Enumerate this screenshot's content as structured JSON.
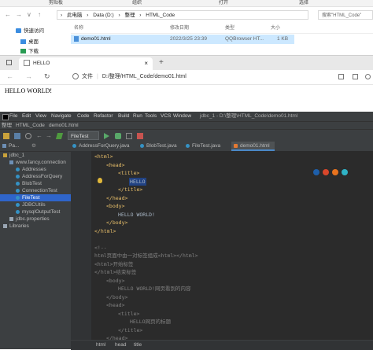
{
  "explorer": {
    "ribbon": [
      "剪贴板",
      "组织",
      "打开",
      "选择"
    ],
    "nav_glyphs": [
      "←",
      "→",
      "∨",
      "↑"
    ],
    "path": [
      "此电脑",
      "Data (D:)",
      "整理",
      "HTML_Code"
    ],
    "path_sep": "›",
    "search_placeholder": "搜索\"HTML_Code\"",
    "sidebar": [
      {
        "label": "快速访问",
        "icon": "star-icon"
      },
      {
        "label": "桌面",
        "icon": "desktop-icon"
      },
      {
        "label": "下载",
        "icon": "download-icon"
      }
    ],
    "columns": [
      "名称",
      "修改日期",
      "类型",
      "大小"
    ],
    "file": {
      "name": "demo01.html",
      "modified": "2022/3/25 23:39",
      "type": "QQBrowser HT...",
      "size": "1 KB"
    }
  },
  "browser": {
    "tab_title": "HELLO",
    "tab_close": "×",
    "new_tab": "+",
    "url_label": "文件",
    "url": "D:/整理/HTML_Code/demo01.html",
    "page_text": "HELLO WORLD!"
  },
  "ide": {
    "menu": [
      "File",
      "Edit",
      "View",
      "Navigate",
      "Code",
      "Refactor",
      "Build",
      "Run",
      "Tools",
      "VCS",
      "Window",
      "Help"
    ],
    "title": "jdbc_1 - D:\\整理\\HTML_Code\\demo01.html",
    "nav_crumbs": [
      "整理",
      "HTML_Code",
      "demo01.html"
    ],
    "run_config": "FileTest",
    "project_header": "Pa...",
    "tree": [
      {
        "label": "jdbc_1",
        "depth": 0
      },
      {
        "label": "www.fancy.connection",
        "depth": 1
      },
      {
        "label": "Addresses",
        "depth": 2
      },
      {
        "label": "AddressForQuery",
        "depth": 2
      },
      {
        "label": "BlobTest",
        "depth": 2
      },
      {
        "label": "ConnectionTest",
        "depth": 2
      },
      {
        "label": "FileTest",
        "depth": 2
      },
      {
        "label": "JDBCUtils",
        "depth": 2
      },
      {
        "label": "mysqlOutputTest",
        "depth": 2
      },
      {
        "label": "jdbc.properties",
        "depth": 1
      },
      {
        "label": "Libraries",
        "depth": 0
      }
    ],
    "selected_tree_item": "FileTest",
    "tabs": [
      "AddressForQuery.java",
      "BlobTest.java",
      "FileTest.java",
      "demo01.html"
    ],
    "active_tab": "demo01.html",
    "code": [
      {
        "t": "<html>",
        "cls": "tag",
        "indent": 0
      },
      {
        "t": "<head>",
        "cls": "tag",
        "indent": 1
      },
      {
        "t": "<title>",
        "cls": "tag",
        "indent": 2
      },
      {
        "t": "HELLO",
        "cls": "txt",
        "indent": 3
      },
      {
        "t": "</title>",
        "cls": "tag",
        "indent": 2
      },
      {
        "t": "</head>",
        "cls": "tag",
        "indent": 1
      },
      {
        "t": "<body>",
        "cls": "tag",
        "indent": 1
      },
      {
        "t": "HELLO WORLD!",
        "cls": "txt",
        "indent": 2
      },
      {
        "t": "</body>",
        "cls": "tag",
        "indent": 1
      },
      {
        "t": "</html>",
        "cls": "tag",
        "indent": 0
      },
      {
        "t": "",
        "cls": "txt",
        "indent": 0
      },
      {
        "t": "<!--",
        "cls": "cmt",
        "indent": 0
      },
      {
        "t": "html页面中由一对标签组成<html></html>",
        "cls": "cmt",
        "indent": 0
      },
      {
        "t": "<html>开始标签",
        "cls": "cmt",
        "indent": 0
      },
      {
        "t": "</html>结束标签",
        "cls": "cmt",
        "indent": 0
      },
      {
        "t": "<body>",
        "cls": "cmt",
        "indent": 1
      },
      {
        "t": "HELLO WORLD!网页看到的内容",
        "cls": "cmt",
        "indent": 2
      },
      {
        "t": "</body>",
        "cls": "cmt",
        "indent": 1
      },
      {
        "t": "<head>",
        "cls": "cmt",
        "indent": 1
      },
      {
        "t": "<title>",
        "cls": "cmt",
        "indent": 2
      },
      {
        "t": "HELLO网页的标题",
        "cls": "cmt",
        "indent": 3
      },
      {
        "t": "</title>",
        "cls": "cmt",
        "indent": 2
      },
      {
        "t": "</head>",
        "cls": "cmt",
        "indent": 1
      }
    ],
    "current_line": 4,
    "highlight_word": "HELLO",
    "breadcrumb": [
      "html",
      "head",
      "title"
    ],
    "colors": {
      "tag": "#e8bf6a",
      "text": "#a9b7c6",
      "comment": "#808080",
      "selection": "#2f65ca"
    }
  }
}
